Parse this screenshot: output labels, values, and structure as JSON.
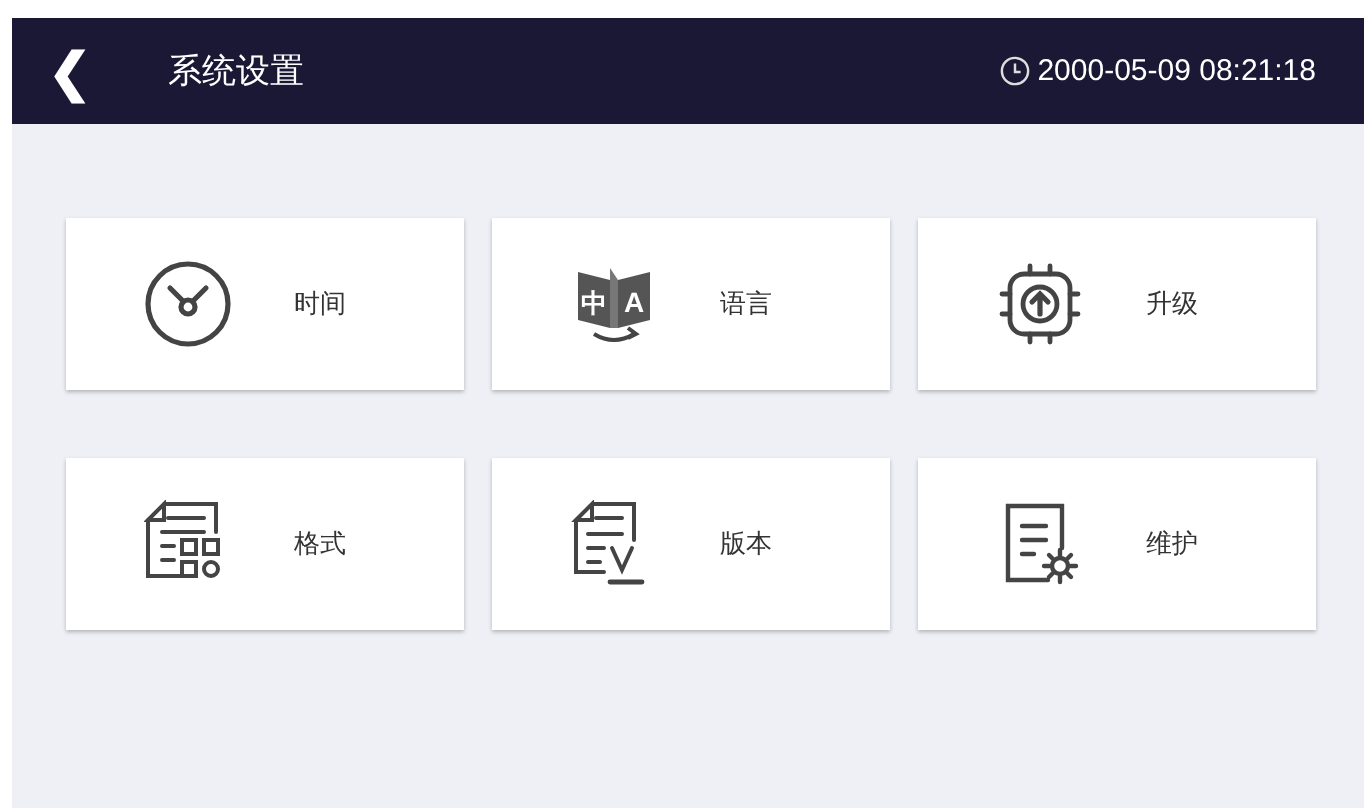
{
  "header": {
    "back": "❮",
    "title": "系统设置",
    "datetime": "2000-05-09 08:21:18"
  },
  "tiles": [
    {
      "kind": "clock",
      "label": "时间"
    },
    {
      "kind": "translate",
      "label": "语言",
      "icon_glyphs": [
        "中",
        "A"
      ]
    },
    {
      "kind": "upgrade",
      "label": "升级"
    },
    {
      "kind": "format",
      "label": "格式"
    },
    {
      "kind": "version",
      "label": "版本"
    },
    {
      "kind": "maintenance",
      "label": "维护"
    }
  ]
}
